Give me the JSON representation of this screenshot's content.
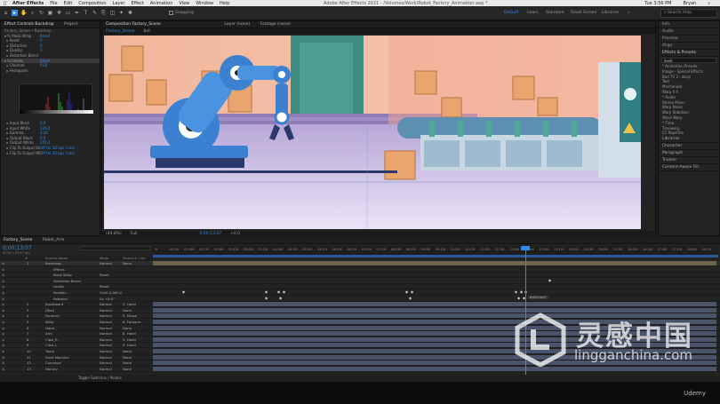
{
  "menu": {
    "apple": "",
    "app": "After Effects",
    "items": [
      "File",
      "Edit",
      "Composition",
      "Layer",
      "Effect",
      "Animation",
      "View",
      "Window",
      "Help"
    ],
    "window_title": "Adobe After Effects 2021 - /Volumes/Work/Robot_Factory_Animation.aep *",
    "right": [
      "Tue 3:56 PM",
      "Bryan"
    ]
  },
  "toolbar": {
    "snapping": "Snapping",
    "workspaces": [
      "Default",
      "Learn",
      "Standard",
      "Small Screen",
      "Libraries"
    ],
    "active_workspace": "Default",
    "search_placeholder": "Search Help"
  },
  "effect_controls": {
    "tabs": [
      "Effect Controls Backdrop",
      "Project"
    ],
    "layer_path": "Factory_Scene • Backdrop",
    "rows": [
      {
        "label": "Mask Wrap",
        "value": "Reset",
        "tw": "fx"
      },
      {
        "label": "Reset",
        "value": "0"
      },
      {
        "label": "Distortion",
        "value": "0"
      },
      {
        "label": "Quality",
        "value": "0"
      },
      {
        "label": "Distortion Blend",
        "value": ""
      },
      {
        "label": "Levels",
        "value": "Reset",
        "tw": "fx",
        "sel": true
      },
      {
        "label": "Channel:",
        "value": "RGB"
      },
      {
        "label": "Histogram",
        "value": ""
      }
    ],
    "rows2": [
      {
        "label": "Input Black",
        "value": "0.0"
      },
      {
        "label": "Input White",
        "value": "226.0"
      },
      {
        "label": "Gamma",
        "value": "1.00"
      },
      {
        "label": "Output Black",
        "value": "0.0"
      },
      {
        "label": "Output White",
        "value": "255.0"
      },
      {
        "label": "Clip To Output Black",
        "value": "Off for 32 bpc Color"
      },
      {
        "label": "Clip To Output White",
        "value": "Off for 32 bpc Color"
      }
    ]
  },
  "composition": {
    "tabs": [
      "Composition Factory_Scene",
      "Layer (none)",
      "Footage (none)"
    ],
    "crumbs": [
      "Factory_Scene",
      "Bot"
    ],
    "footer": [
      "(49.8%)",
      "Full",
      "0;00;13;07",
      "+0.0"
    ]
  },
  "right_panel": {
    "items": [
      "Info",
      "Audio",
      "Preview",
      "Align",
      "Effects & Presets"
    ],
    "search": "level",
    "tree": [
      "* Animation Presets",
      "Image - Special Effects",
      "Bad TV 2 - warp",
      "Text",
      "Mechanical",
      "Warp II 4",
      "* Audio",
      "Stereo Mixer",
      "Warp Noise",
      "Warp Stabilizer",
      "Wave Warp",
      "* Time",
      "Timewarp",
      "CC RepeTile",
      "Libraries",
      "Character",
      "Paragraph",
      "Tracker",
      "Content-Aware Fill"
    ],
    "highlight": "Levels"
  },
  "timeline": {
    "tabs": [
      "Factory_Scene",
      "Robot_Arm"
    ],
    "time": "0;00;13;07",
    "fps": "00397 (29.97 fps)",
    "ruler": [
      "0f",
      "00:15f",
      "01:00f",
      "01:15f",
      "02:00f",
      "02:15f",
      "03:00f",
      "03:15f",
      "04:00f",
      "04:15f",
      "05:00f",
      "05:15f",
      "06:00f",
      "06:15f",
      "07:00f",
      "07:15f",
      "08:00f",
      "08:15f",
      "09:00f",
      "09:15f",
      "10:00f",
      "10:15f",
      "11:00f",
      "11:15f",
      "12:00f",
      "12:15f",
      "13:00f",
      "13:15f",
      "14:00f",
      "14:15f",
      "15:00f",
      "15:15f",
      "16:00f",
      "16:15f",
      "17:00f",
      "17:15f",
      "18:00f",
      "18:15f"
    ],
    "col_headers": [
      "#",
      "Source Name",
      "Mode",
      "Parent & Link"
    ],
    "layers": [
      {
        "n": "1",
        "name": "Backdrop",
        "mode": "Normal",
        "parent": "None",
        "sel": true
      },
      {
        "n": "",
        "name": "Effects",
        "mode": "",
        "parent": ""
      },
      {
        "n": "",
        "name": "Mask Wrap",
        "mode": "Reset",
        "parent": ""
      },
      {
        "n": "",
        "name": "Distortion Blend",
        "mode": "",
        "parent": ""
      },
      {
        "n": "",
        "name": "Levels",
        "mode": "Reset",
        "parent": ""
      },
      {
        "n": "",
        "name": "Position",
        "mode": "2000.0,960.0",
        "parent": ""
      },
      {
        "n": "",
        "name": "Rotation",
        "mode": "0x +0.0°",
        "parent": ""
      },
      {
        "n": "2",
        "name": "Backboard",
        "mode": "Normal",
        "parent": "3. Hand"
      },
      {
        "n": "3",
        "name": "[Box]",
        "mode": "Normal",
        "parent": "None"
      },
      {
        "n": "4",
        "name": "Forearm",
        "mode": "Normal",
        "parent": "5. Elbow"
      },
      {
        "n": "5",
        "name": "Wrist",
        "mode": "Normal",
        "parent": "6. Forearm"
      },
      {
        "n": "6",
        "name": "Hand",
        "mode": "Normal",
        "parent": "None"
      },
      {
        "n": "7",
        "name": "Arm",
        "mode": "Normal",
        "parent": "8. Hand"
      },
      {
        "n": "8",
        "name": "Claw_R",
        "mode": "Normal",
        "parent": "9. Hand"
      },
      {
        "n": "9",
        "name": "Claw_L",
        "mode": "Normal",
        "parent": "9. Hand"
      },
      {
        "n": "10",
        "name": "Track",
        "mode": "Normal",
        "parent": "None"
      },
      {
        "n": "11",
        "name": "Front Machine",
        "mode": "Normal",
        "parent": "None"
      },
      {
        "n": "12",
        "name": "Conveyor",
        "mode": "Normal",
        "parent": "None"
      },
      {
        "n": "13",
        "name": "Factory",
        "mode": "Normal",
        "parent": "None"
      }
    ],
    "footer": "Toggle Switches / Modes",
    "keyframe_label": "0;00;13;07"
  },
  "watermark": {
    "cn": "灵感中国",
    "en": "lingganchina.com",
    "corner": "Udemy"
  },
  "colors": {
    "accent": "#2d8ceb",
    "bg": "#1b1b1b"
  }
}
